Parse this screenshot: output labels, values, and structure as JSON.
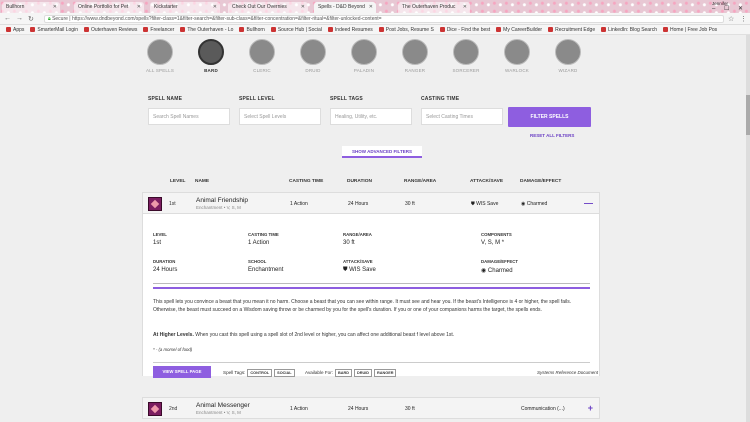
{
  "browser": {
    "tabs": [
      {
        "label": "Bullhorn",
        "active": false
      },
      {
        "label": "Online Portfolio for Pet",
        "active": false
      },
      {
        "label": "Kickstarter",
        "active": false
      },
      {
        "label": "Check Out Our Overnies",
        "active": false
      },
      {
        "label": "Spells - D&D Beyond",
        "active": true
      },
      {
        "label": "The Outerhaven Produc",
        "active": false
      }
    ],
    "window_user": "Jennifer",
    "secure_label": "Secure",
    "url": "https://www.dndbeyond.com/spells?filter-class=1&filter-search=&filter-sub-class=&filter-concentration=&filter-ritual=&filter-unlocked-content=",
    "bookmarks": [
      "Apps",
      "SmarterMail Login",
      "Outerhaven Reviews",
      "Freelancer",
      "The Outerhaven - Lo",
      "Bullhorn",
      "Source Hub | Social",
      "Indeed Resumes",
      "Post Jobs, Resume S",
      "Dice - Find the best",
      "My CareerBuilder",
      "Recruitment Edge",
      "LinkedIn: Blog Search",
      "Home | Free Job Pos"
    ]
  },
  "classes": [
    {
      "label": "ALL SPELLS",
      "active": false
    },
    {
      "label": "BARD",
      "active": true
    },
    {
      "label": "CLERIC",
      "active": false
    },
    {
      "label": "DRUID",
      "active": false
    },
    {
      "label": "PALADIN",
      "active": false
    },
    {
      "label": "RANGER",
      "active": false
    },
    {
      "label": "SORCERER",
      "active": false
    },
    {
      "label": "WARLOCK",
      "active": false
    },
    {
      "label": "WIZARD",
      "active": false
    }
  ],
  "filters": {
    "name_label": "SPELL NAME",
    "name_placeholder": "Search Spell Names",
    "level_label": "SPELL LEVEL",
    "level_placeholder": "Select Spell Levels",
    "tags_label": "SPELL TAGS",
    "tags_placeholder": "Healing, Utility, etc.",
    "time_label": "CASTING TIME",
    "time_placeholder": "Select Casting Times",
    "filter_button": "FILTER SPELLS",
    "reset": "RESET ALL FILTERS",
    "advanced": "SHOW ADVANCED FILTERS"
  },
  "columns": {
    "level": "LEVEL",
    "name": "NAME",
    "casting": "CASTING TIME",
    "duration": "DURATION",
    "range": "RANGE/AREA",
    "attack": "ATTACK/SAVE",
    "damage": "DAMAGE/EFFECT"
  },
  "spells": [
    {
      "level": "1st",
      "name": "Animal Friendship",
      "sub": "Enchantment • V, S, M",
      "casting": "1 Action",
      "duration": "24 Hours",
      "range": "30 ft",
      "attack": "WIS Save",
      "damage": "Charmed",
      "toggle": "—"
    },
    {
      "level": "2nd",
      "name": "Animal Messenger",
      "sub": "Enchantment • V, S, M",
      "casting": "1 Action",
      "duration": "24 Hours",
      "range": "30 ft",
      "attack": "",
      "damage": "Communication (...)",
      "toggle": "+"
    }
  ],
  "detail": {
    "level_l": "LEVEL",
    "level_v": "1st",
    "casting_l": "CASTING TIME",
    "casting_v": "1 Action",
    "range_l": "RANGE/AREA",
    "range_v": "30 ft",
    "comp_l": "COMPONENTS",
    "comp_v": "V, S, M *",
    "duration_l": "DURATION",
    "duration_v": "24 Hours",
    "school_l": "SCHOOL",
    "school_v": "Enchantment",
    "attack_l": "ATTACK/SAVE",
    "attack_v": "WIS Save",
    "damage_l": "DAMAGE/EFFECT",
    "damage_v": "Charmed",
    "description": "This spell lets you convince a beast that you mean it no harm. Choose a beast that you can see within range. It must see and hear you. If the beast's Intelligence is 4 or higher, the spell fails. Otherwise, the beast must succeed on a Wisdom saving throw or be charmed by you for the spell's duration. If you or one of your companions harms the target, the spells ends.",
    "higher_label": "At Higher Levels.",
    "higher_text": " When you cast this spell using a spell slot of 2nd level or higher, you can affect one additional beast f level above 1st.",
    "material": "* - (a morsel of food)",
    "view_button": "VIEW SPELL PAGE",
    "tags_label": "Spell Tags:",
    "tags": [
      "CONTROL",
      "SOCIAL"
    ],
    "available_label": "Available For:",
    "available": [
      "BARD",
      "DRUID",
      "RANGER"
    ],
    "source": "Systems Reference Document"
  }
}
